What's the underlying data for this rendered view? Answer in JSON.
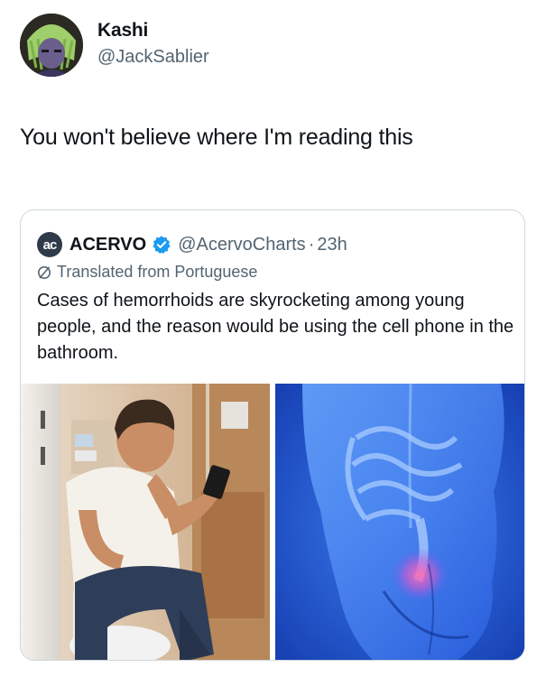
{
  "author": {
    "name": "Kashi",
    "handle": "@JackSablier"
  },
  "tweet": {
    "text": "You won't believe where I'm reading this"
  },
  "quote": {
    "logo_text": "ac",
    "name": "ACERVO",
    "verified_icon": "verified-badge-icon",
    "handle": "@AcervoCharts",
    "separator": "·",
    "time": "23h",
    "translated_label": "Translated from Portuguese",
    "text": "Cases of hemorrhoids are skyrocketing among young people, and the reason would be using the cell phone in the bathroom.",
    "media": [
      {
        "description_icon": "photo-man-on-toilet-with-phone"
      },
      {
        "description_icon": "photo-anatomy-illustration"
      }
    ]
  },
  "colors": {
    "primary_text": "#0f1419",
    "secondary_text": "#536471",
    "border": "#cfd9de",
    "verified_blue": "#1d9bf0"
  }
}
